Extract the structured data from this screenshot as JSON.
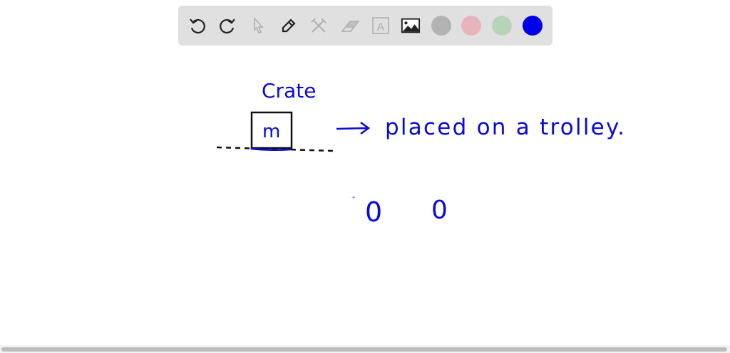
{
  "toolbar": {
    "tools": [
      "undo-icon",
      "redo-icon",
      "select-icon",
      "pen-icon",
      "tools-icon",
      "eraser-icon",
      "text-icon",
      "image-icon"
    ],
    "text_tool_glyph": "A",
    "colors": [
      "#b3b3b3",
      "#e8b4bb",
      "#b8d4b8",
      "#0000e6"
    ],
    "selected_color": "#0000e6"
  },
  "canvas": {
    "label_crate": "Crate",
    "mass_label": "m",
    "description": "placed on a trolley.",
    "zero_1": "0",
    "zero_2": "0",
    "ink_color": "#0a0ad8"
  }
}
